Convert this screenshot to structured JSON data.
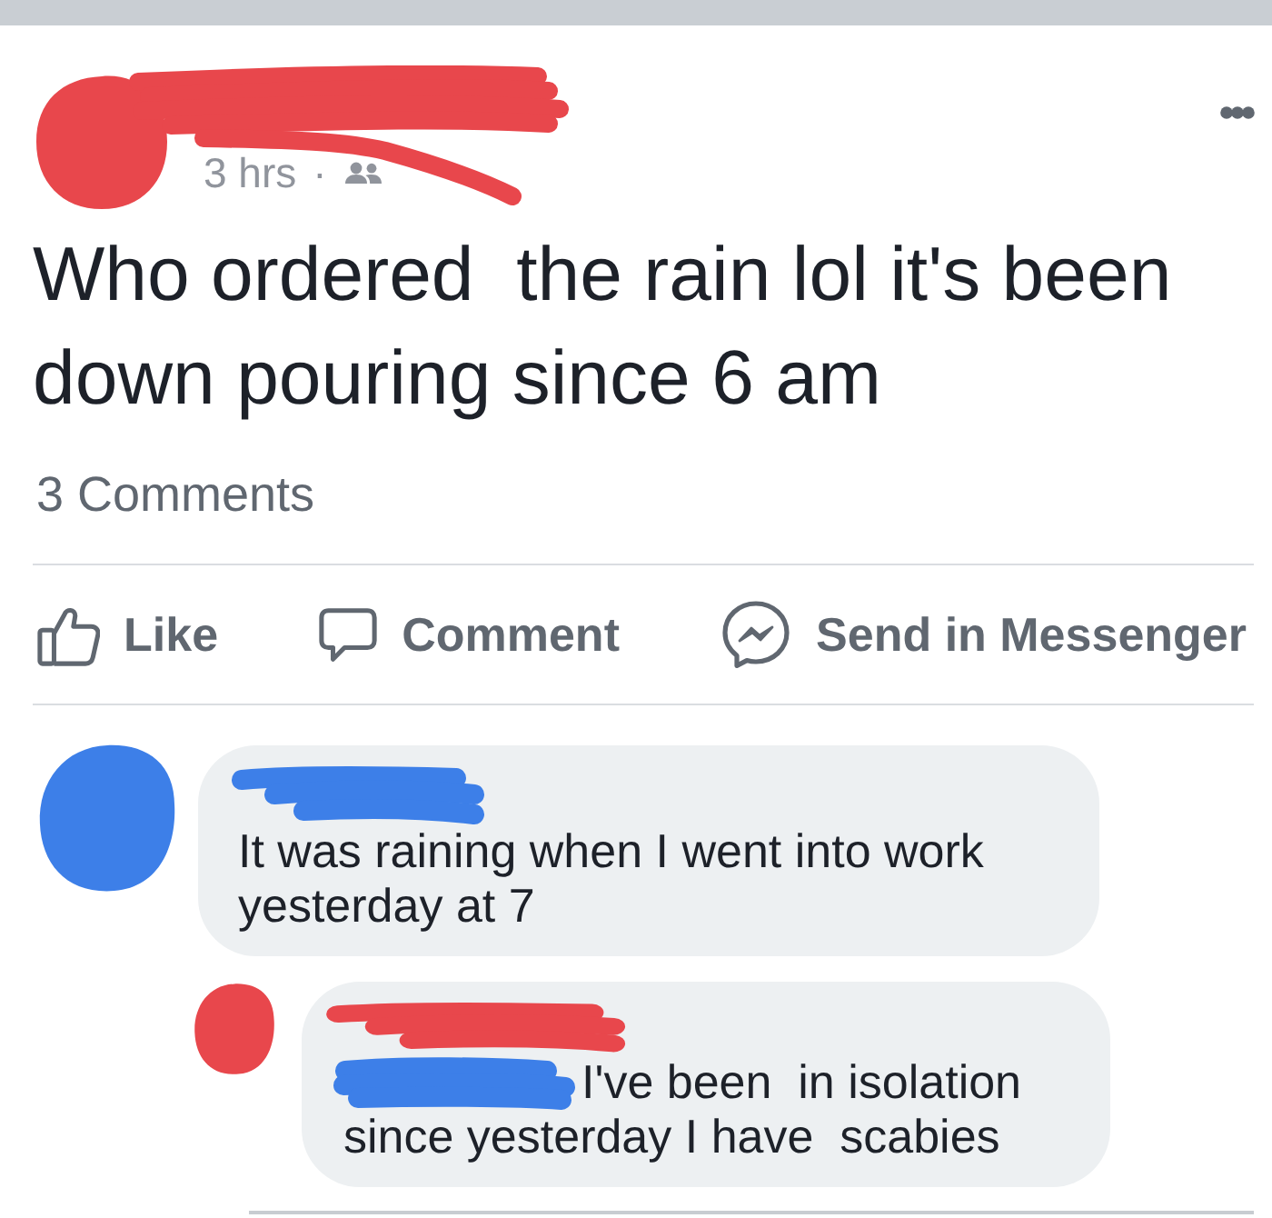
{
  "post": {
    "author_scribble": {
      "color": "#e8474c"
    },
    "time": "3 hrs",
    "separator": "·",
    "text": "Who ordered  the rain lol it's been down pouring since 6 am",
    "comment_count": "3 Comments"
  },
  "actions": [
    {
      "kind": "like",
      "label": "Like"
    },
    {
      "kind": "comment",
      "label": "Comment"
    },
    {
      "kind": "messenger",
      "label": "Send in Messenger"
    }
  ],
  "comments": [
    {
      "avatar_scribble": {
        "color": "#3d7fe8"
      },
      "name_scribble": {
        "color": "#3d7fe8"
      },
      "text": "It was raining when I went into work yesterday at 7",
      "children": [
        {
          "avatar_scribble": {
            "color": "#e8474c"
          },
          "name_scribble": {
            "color": "#e8474c"
          },
          "text_scribble": {
            "color": "#3d7fe8"
          },
          "text": "I've been  in isolation since yesterday I have  scabies"
        }
      ]
    }
  ]
}
